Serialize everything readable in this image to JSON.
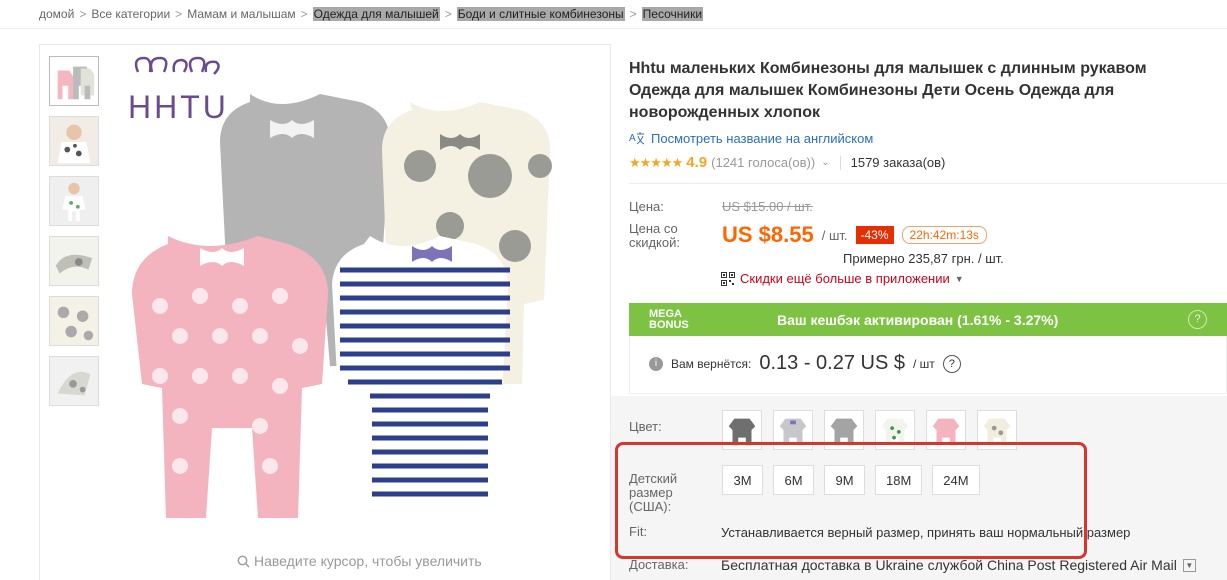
{
  "breadcrumb": {
    "items": [
      "домой",
      "Все категории",
      "Мамам и малышам",
      "Одежда для малышей",
      "Боди и слитные комбинезоны",
      "Песочники"
    ],
    "separator": ">"
  },
  "gallery": {
    "brand_logo": "HHTU",
    "zoom_hint": "Наведите курсор, чтобы увеличить"
  },
  "product": {
    "title": "Hhtu маленьких Комбинезоны для малышек с длинным рукавом Одежда для малышек Комбинезоны Дети Осень Одежда для новорожденных хлопок",
    "translate_link": "Посмотреть название на английском",
    "stars": "★★★★★",
    "rating": "4.9",
    "votes": "(1241 голоса(ов))",
    "orders": "1579 заказа(ов)"
  },
  "price": {
    "price_label": "Цена:",
    "old_price": "US $15.00 / шт.",
    "discount_label_line1": "Цена со",
    "discount_label_line2": "скидкой:",
    "new_price": "US $8.55",
    "unit": "/ шт.",
    "discount": "-43%",
    "timer": "22h:42m:13s",
    "approx": "Примерно 235,87 грн. / шт.",
    "app_promo": "Скидки ещё больше в приложении"
  },
  "mega_bonus": {
    "logo_line1": "MEGA",
    "logo_line2": "BONUS",
    "text": "Ваш кешбэк активирован (1.61% - 3.27%)",
    "help": "?"
  },
  "cashback": {
    "label": "Вам вернётся:",
    "amount": "0.13 - 0.27 US $",
    "per": "/ шт",
    "help": "?"
  },
  "sku": {
    "color_label": "Цвет:",
    "size_label_line1": "Детский",
    "size_label_line2": "размер",
    "size_label_line3": "(США):",
    "sizes": [
      "3M",
      "6M",
      "9M",
      "18M",
      "24M"
    ],
    "fit_label": "Fit:",
    "fit_value": "Устанавливается верный размер, принять ваш нормальный размер",
    "shipping_label": "Доставка:",
    "shipping_value": "Бесплатная доставка в Ukraine службой China Post Registered Air Mail"
  },
  "colors": {
    "accent_orange": "#ff6600",
    "discount_red": "#e62e04",
    "mega_green": "#7dc242",
    "link_blue": "#2a6fbf",
    "annotation_red": "#d9362b"
  }
}
